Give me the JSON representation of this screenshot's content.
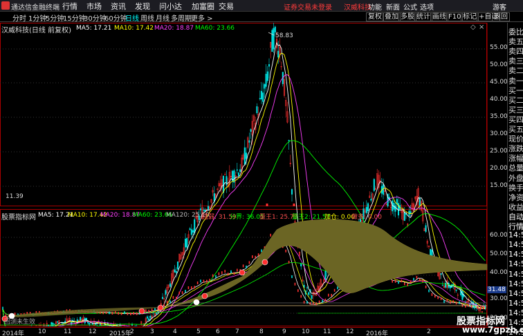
{
  "app": {
    "name": "通达信金融终端",
    "logo_icon": "app-logo-icon"
  },
  "menus": [
    "行情",
    "市场",
    "资讯",
    "发现",
    "问小达",
    "加富圈",
    "交易"
  ],
  "warn": {
    "text1": "证券交易未登录",
    "text2": "汉威科技"
  },
  "right_menus": [
    "功能",
    "新面",
    "公式",
    "选项",
    "游客"
  ],
  "periods": [
    "分时",
    "1分钟",
    "5分钟",
    "15分钟",
    "30分钟",
    "60分钟",
    "日线",
    "周线",
    "月线",
    "多周期",
    "更多 >"
  ],
  "active_period": "日线",
  "toolbar_buttons": [
    "复权",
    "叠加",
    "多股",
    "统计",
    "画线",
    "F10",
    "标记",
    "+自选",
    "返回"
  ],
  "main_chart": {
    "title": "汉威科技(日线 前复权)",
    "ma_labels": [
      {
        "text": "MA5: 17.21",
        "color": "#ffffff"
      },
      {
        "text": "MA10: 17.42",
        "color": "#ffff00"
      },
      {
        "text": "MA20: 18.87",
        "color": "#ff40ff"
      },
      {
        "text": "MA60: 23.66",
        "color": "#00ff00"
      }
    ],
    "price_axis": [
      "55.00",
      "50.00",
      "45.00",
      "40.00",
      "35.00",
      "30.00",
      "25.00",
      "20.00",
      "15.00"
    ],
    "high_label": "58.83",
    "low_label": "11.39"
  },
  "indicator": {
    "title": "股票指标网",
    "labels": [
      {
        "text": "MA5: 17.21",
        "color": "#ffffff"
      },
      {
        "text": "MA10: 17.42",
        "color": "#ffff00"
      },
      {
        "text": "MA20: 18.87",
        "color": "#ff40ff"
      },
      {
        "text": "MA60: 23.66",
        "color": "#00ff00"
      },
      {
        "text": "MA120: 25.10",
        "color": "#bbbbbb"
      },
      {
        "text": "强弱: 31.59",
        "color": "#ff5050"
      },
      {
        "text": "分界: 36.05",
        "color": "#00ff00"
      },
      {
        "text": "量王1: 25.73",
        "color": "#ff5050"
      },
      {
        "text": "量王2: 21.57",
        "color": "#00ff00"
      },
      {
        "text": "加仓: 0.00",
        "color": "#ffff00"
      },
      {
        "text": "做多: 0.00",
        "color": "#ff5050"
      }
    ],
    "axis": [
      "60.00",
      "50.00",
      "40.00",
      "30.00",
      "20.00"
    ],
    "current_value": "31.48",
    "bottom_text": "回测未生效"
  },
  "right_panel": [
    "委比",
    "卖五",
    "卖四",
    "卖三",
    "卖二",
    "卖一",
    "买一",
    "买二",
    "买三",
    "买四",
    "买五",
    "现价",
    "涨跌",
    "涨幅",
    "总量",
    "外盘",
    "换手",
    "净资",
    "收益",
    "自动",
    "行情",
    "14:5",
    "14:5",
    "14:5",
    "14:5",
    "14:5",
    "14:5",
    "14:5",
    "14:5",
    "14:5",
    "14:5",
    "14:5"
  ],
  "dates": [
    "2014年",
    "10",
    "11",
    "12",
    "2015年",
    "2",
    "3",
    "4",
    "5",
    "6",
    "7",
    "8",
    "9",
    "10",
    "11",
    "12",
    "2016年",
    "2"
  ],
  "watermark": {
    "line1": "股票指标网",
    "line2": "www.7gpzb.com"
  }
}
